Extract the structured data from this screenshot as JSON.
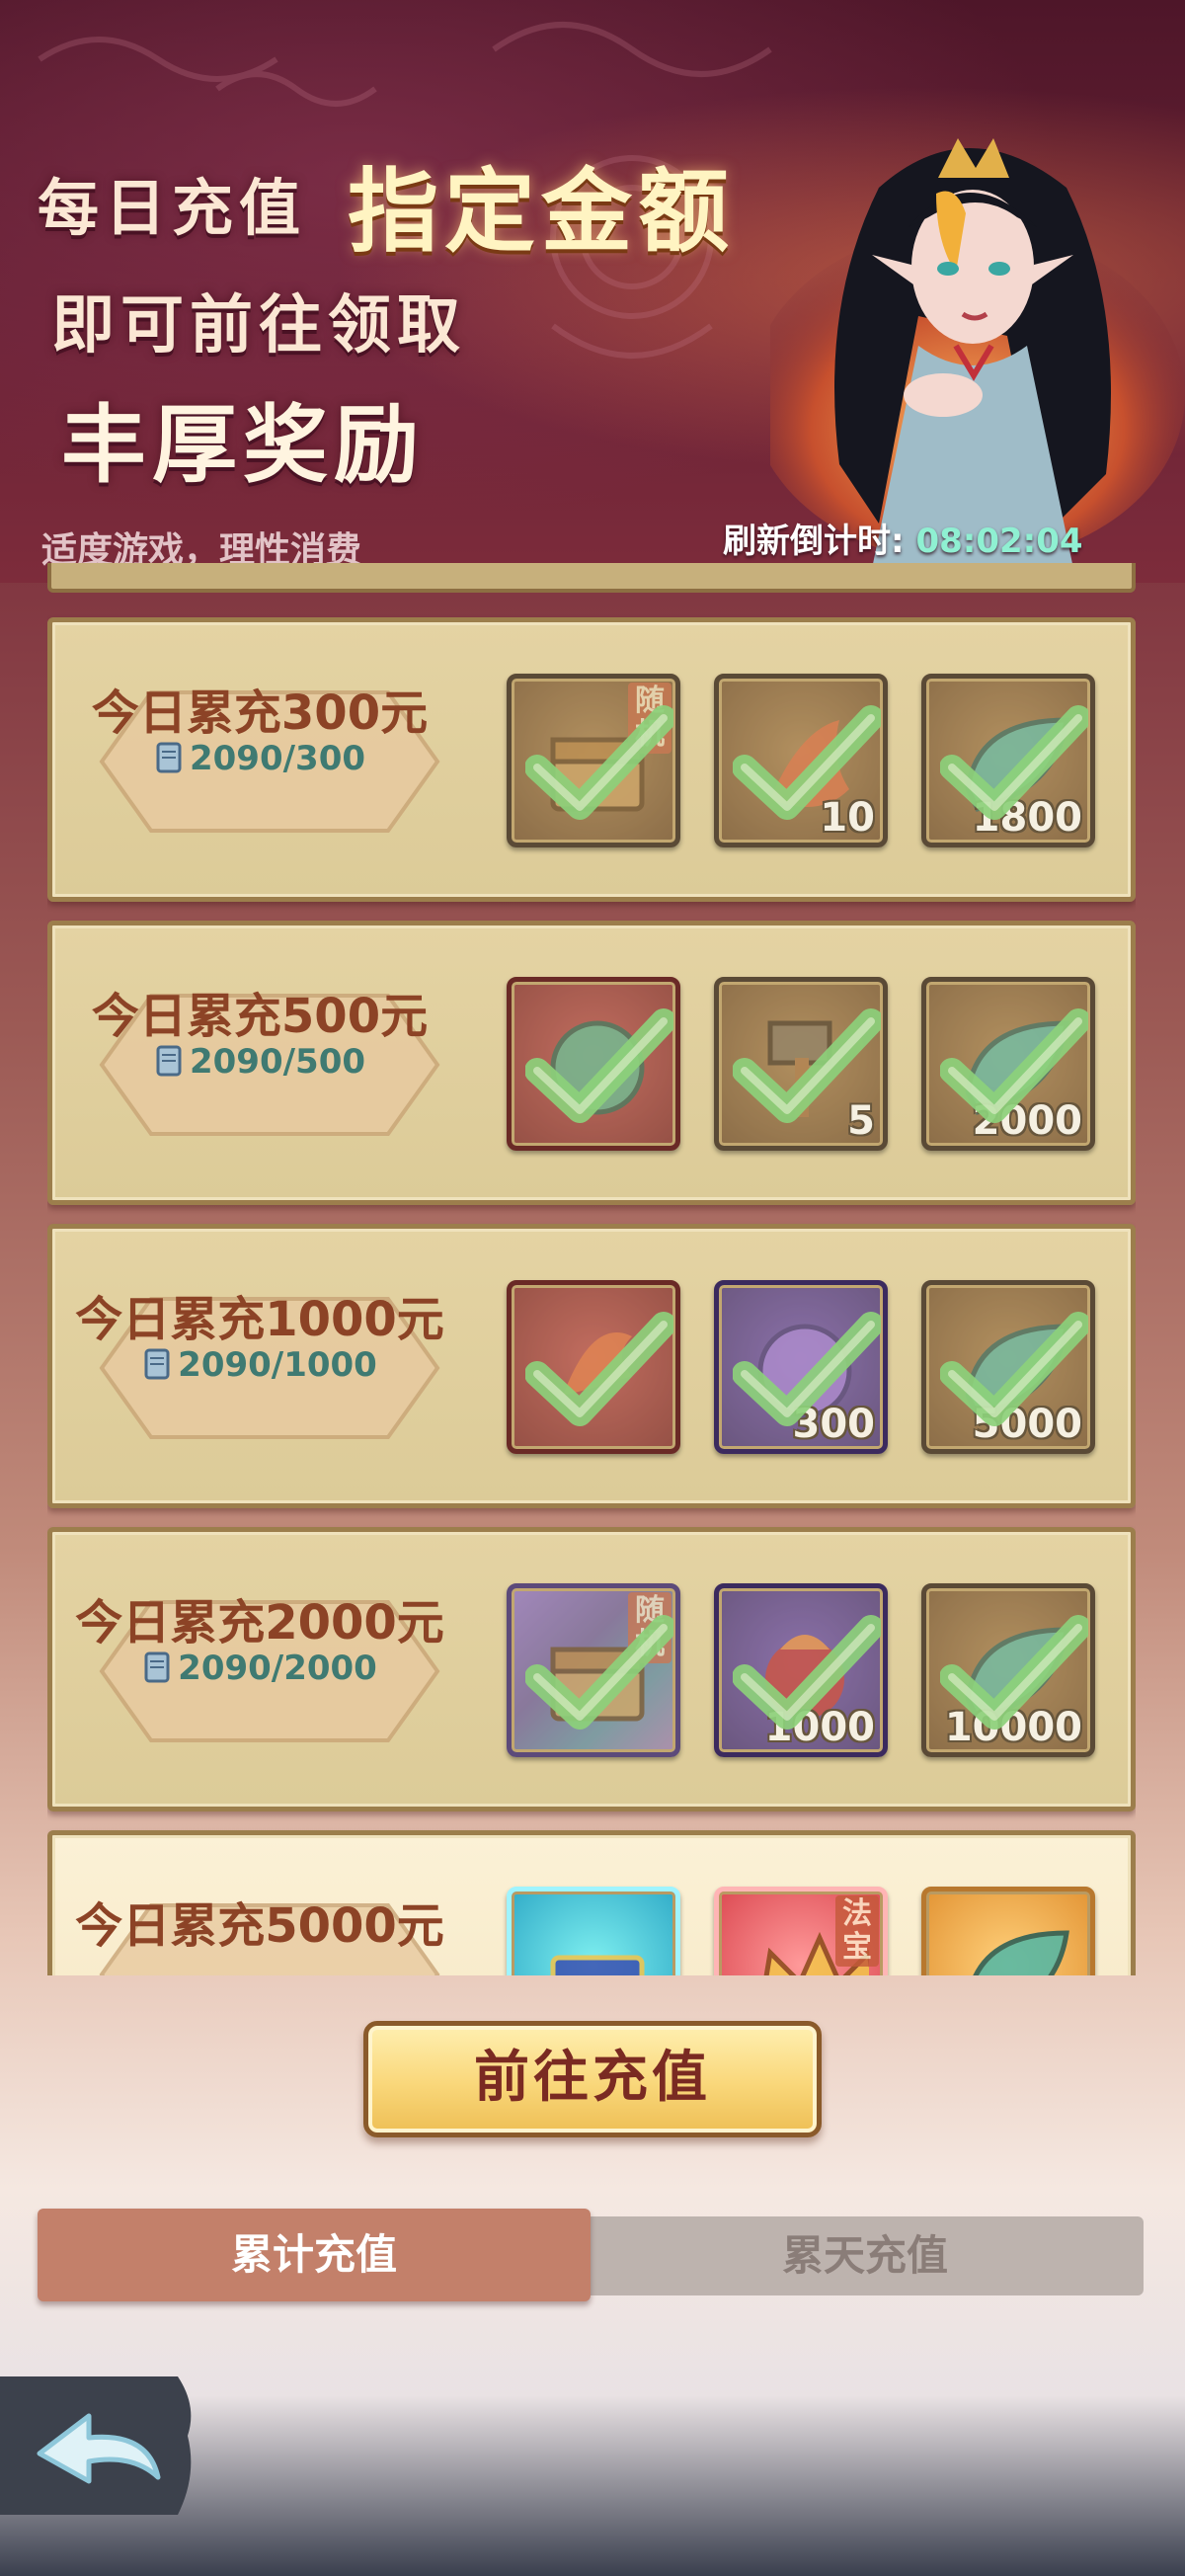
{
  "header": {
    "line1_a": "每日充值",
    "line1_b": "指定金额",
    "line2": "即可前往领取",
    "line3": "丰厚奖励",
    "tagline": "适度游戏，理性消费",
    "countdown_label": "刷新倒计时:",
    "countdown_time": "08:02:04"
  },
  "tiers": [
    {
      "title": "今日累充300元",
      "progress": "2090/300",
      "rewards": [
        {
          "icon": "chest-icon",
          "tag": "随机",
          "qty": "",
          "claimed": true
        },
        {
          "icon": "flame-shard-icon",
          "tag": "",
          "qty": "10",
          "claimed": true
        },
        {
          "icon": "jade-leaf-icon",
          "tag": "",
          "qty": "1800",
          "claimed": true
        }
      ]
    },
    {
      "title": "今日累充500元",
      "progress": "2090/500",
      "rewards": [
        {
          "icon": "orb-icon",
          "tag": "",
          "qty": "",
          "claimed": true
        },
        {
          "icon": "hammer-icon",
          "tag": "",
          "qty": "5",
          "claimed": true
        },
        {
          "icon": "jade-leaf-icon",
          "tag": "",
          "qty": "2000",
          "claimed": true
        }
      ]
    },
    {
      "title": "今日累充1000元",
      "progress": "2090/1000",
      "rewards": [
        {
          "icon": "phoenix-icon",
          "tag": "",
          "qty": "",
          "claimed": true
        },
        {
          "icon": "purple-orb-icon",
          "tag": "",
          "qty": "300",
          "claimed": true
        },
        {
          "icon": "jade-leaf-icon",
          "tag": "",
          "qty": "5000",
          "claimed": true
        }
      ]
    },
    {
      "title": "今日累充2000元",
      "progress": "2090/2000",
      "rewards": [
        {
          "icon": "chest-icon",
          "tag": "随机",
          "qty": "",
          "claimed": true
        },
        {
          "icon": "fire-orb-icon",
          "tag": "",
          "qty": "1000",
          "claimed": true
        },
        {
          "icon": "jade-leaf-icon",
          "tag": "",
          "qty": "10000",
          "claimed": true
        }
      ]
    },
    {
      "title": "今日累充5000元",
      "progress": "",
      "rewards": [
        {
          "icon": "gem-chest-icon",
          "tag": "",
          "qty": "",
          "claimed": false
        },
        {
          "icon": "crown-icon",
          "tag": "法宝",
          "qty": "",
          "claimed": false
        },
        {
          "icon": "jade-leaf-icon",
          "tag": "",
          "qty": "",
          "claimed": false
        }
      ]
    }
  ],
  "buttons": {
    "go_recharge": "前往充值"
  },
  "tabs": {
    "active": "累计充值",
    "inactive": "累天充值"
  },
  "colors": {
    "title_text": "#8c4326",
    "progress_text": "#3f7a72",
    "countdown_time": "#8ff0d2",
    "check_green": "#6fd470",
    "tab_active_bg": "#c3806a",
    "tab_inactive_bg": "#bdb3ae"
  }
}
